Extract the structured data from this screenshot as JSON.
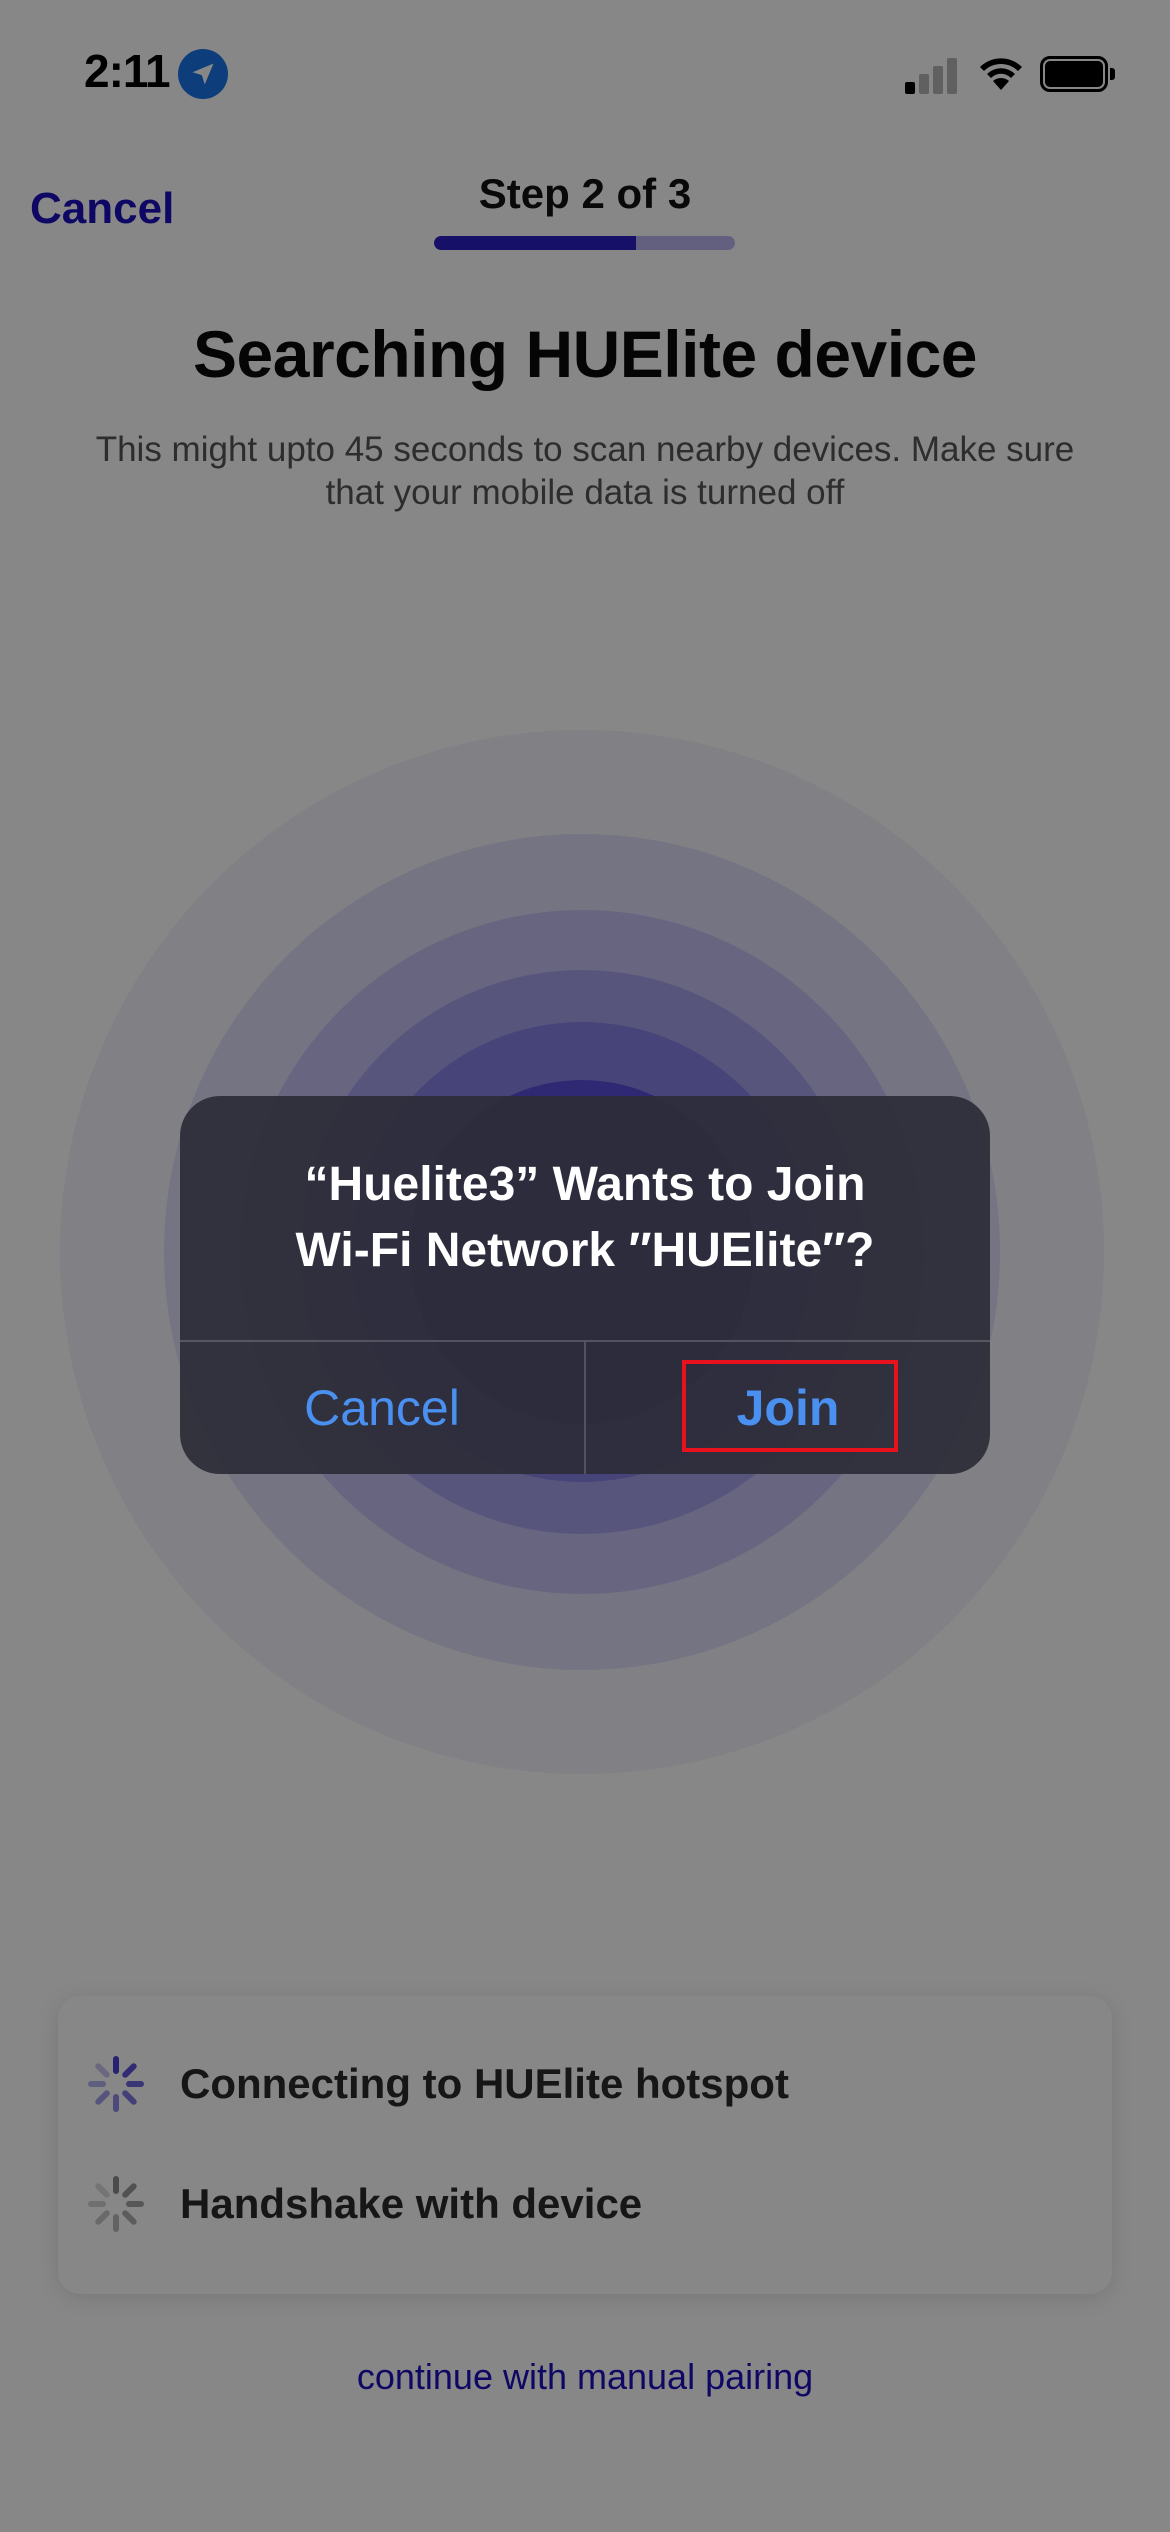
{
  "status_bar": {
    "time": "2:11",
    "location_icon": "location-arrow-icon",
    "signal_icon": "cellular-signal-icon",
    "wifi_icon": "wifi-icon",
    "battery_icon": "battery-icon"
  },
  "header": {
    "cancel_label": "Cancel",
    "step_label": "Step 2 of 3",
    "step_progress": 0.67
  },
  "main": {
    "title": "Searching HUElite device",
    "subtitle": "This might upto 45 seconds to scan nearby devices. Make sure that your mobile data is turned off"
  },
  "status_card": {
    "items": [
      {
        "label": "Connecting to HUElite hotspot",
        "icon": "spinner-icon",
        "state": "active"
      },
      {
        "label": "Handshake with device",
        "icon": "spinner-icon",
        "state": "pending"
      }
    ]
  },
  "manual_link": "continue with manual pairing",
  "alert": {
    "title_line1": "“Huelite3” Wants to Join",
    "title_line2": "Wi-Fi Network ″HUElite″?",
    "cancel_label": "Cancel",
    "join_label": "Join"
  },
  "colors": {
    "accent": "#1c0fbe",
    "progress_fill": "#2b1fc4",
    "alert_button": "#4a90f0",
    "highlight": "#e8121f"
  }
}
